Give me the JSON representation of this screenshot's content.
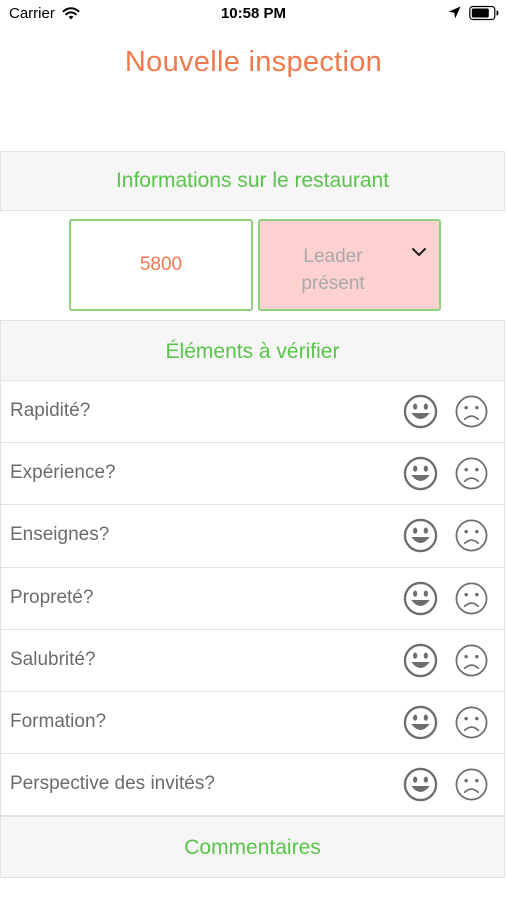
{
  "status_bar": {
    "carrier": "Carrier",
    "time": "10:58 PM",
    "icons": [
      "wifi-icon",
      "location-arrow-icon",
      "battery-icon"
    ]
  },
  "header": {
    "title": "Nouvelle inspection"
  },
  "restaurant_section": {
    "title": "Informations sur le restaurant",
    "restaurant_number": "5800",
    "leader_select": {
      "line1": "Leader",
      "line2": "présent"
    }
  },
  "elements_section": {
    "title": "Éléments à vérifier",
    "items": [
      {
        "label": "Rapidité?"
      },
      {
        "label": "Expérience?"
      },
      {
        "label": "Enseignes?"
      },
      {
        "label": "Propreté?"
      },
      {
        "label": "Salubrité?"
      },
      {
        "label": "Formation?"
      },
      {
        "label": "Perspective des invités?"
      }
    ]
  },
  "comments_section": {
    "title": "Commentaires"
  },
  "colors": {
    "title_orange": "#f07a4d",
    "section_green": "#59c44a",
    "input_border_green": "#8fd07f",
    "select_background": "#fdd1cf",
    "icon_gray": "#6e6e6e"
  }
}
